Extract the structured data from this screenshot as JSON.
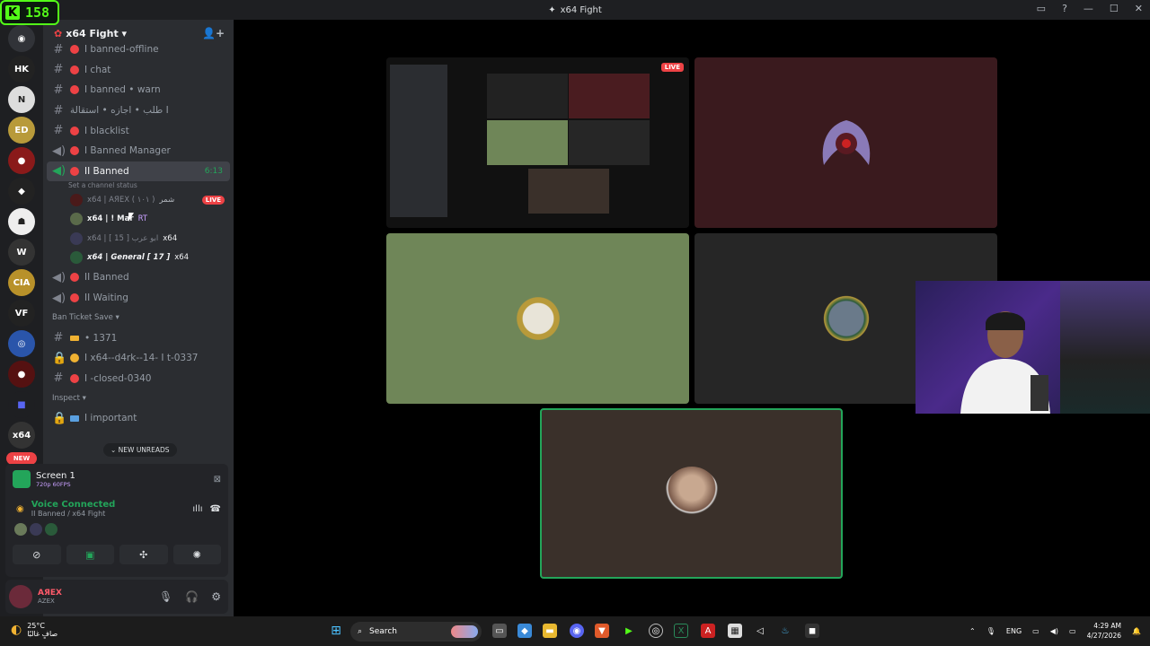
{
  "kick": {
    "count": "158",
    "logo": "K"
  },
  "window": {
    "title": "x64 Fight"
  },
  "guild": {
    "name": "x64 Fight ▾"
  },
  "channels_top": [
    {
      "label": "I banned-offline",
      "type": "text"
    },
    {
      "label": "I chat",
      "type": "text"
    },
    {
      "label": "I banned • warn",
      "type": "text"
    },
    {
      "label": "طلب • اجازه • استقالة I",
      "type": "text"
    },
    {
      "label": "I blacklist",
      "type": "text"
    },
    {
      "label": "I Banned Manager",
      "type": "voice"
    }
  ],
  "active_channel": {
    "label": "II Banned",
    "timer": "6:13",
    "status": "Set a channel status"
  },
  "voice_users": [
    {
      "name": "x64 | AЯEX ( ۱۰۱ )",
      "tag": "شمر",
      "live": "LIVE"
    },
    {
      "name": "x64 | ! Mar",
      "tag": "RT",
      "live": ""
    },
    {
      "name": "x64 | [ 15 ] ابو عرب",
      "tag": "x64",
      "live": ""
    },
    {
      "name": "x64 | General [ 17 ]",
      "tag": "x64",
      "live": ""
    }
  ],
  "channels_mid": [
    {
      "label": "II Banned",
      "type": "voice"
    },
    {
      "label": "II Waiting",
      "type": "voice"
    }
  ],
  "category_ban": "Ban Ticket Save ▾",
  "ban_channels": [
    {
      "label": "• 1371",
      "type": "text"
    },
    {
      "label": "I x64--d4rk--14- I t-0337",
      "type": "lock"
    },
    {
      "label": "I -closed-0340",
      "type": "text"
    }
  ],
  "category_inspect": "Inspect ▾",
  "inspect_channels": [
    {
      "label": "I important",
      "type": "lock"
    }
  ],
  "new_unreads": "NEW UNREADS",
  "new_badge": "NEW",
  "screen_share": {
    "title": "Screen 1",
    "sub": "720p 60FPS"
  },
  "voice_connected": {
    "title": "Voice Connected",
    "sub": "II Banned / x64 Fight"
  },
  "user": {
    "name": "AЯEX",
    "sub": "AZEX"
  },
  "taskbar": {
    "temp": "25°C",
    "weather": "صافٍ غالبًا",
    "search": "Search",
    "lang": "ENG",
    "time": "4:29 AM",
    "date": "4/27/2026"
  },
  "tiles": {
    "live": "LIVE"
  },
  "colors": {
    "discord_green": "#23a55a",
    "red": "#ed4245",
    "kick_green": "#53fc18"
  }
}
